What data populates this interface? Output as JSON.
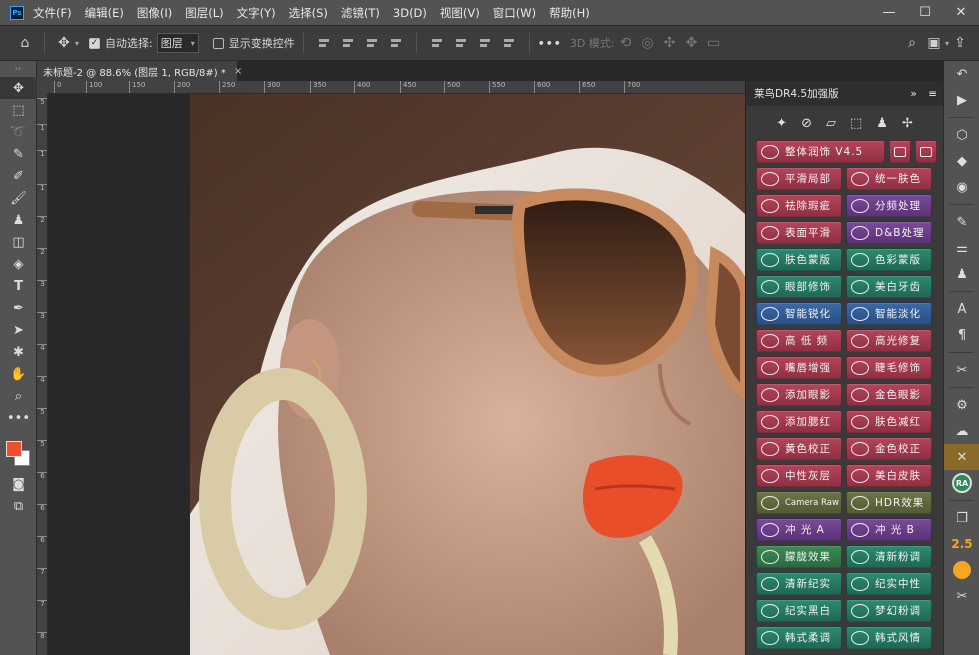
{
  "app": {
    "logo": "Ps"
  },
  "menu": [
    "文件(F)",
    "编辑(E)",
    "图像(I)",
    "图层(L)",
    "文字(Y)",
    "选择(S)",
    "滤镜(T)",
    "3D(D)",
    "视图(V)",
    "窗口(W)",
    "帮助(H)"
  ],
  "window_controls": {
    "minimize": "—",
    "maximize": "☐",
    "close": "✕"
  },
  "options": {
    "auto_select_label": "自动选择:",
    "auto_select_checked": true,
    "auto_select_value": "图层",
    "show_transform_label": "显示变换控件",
    "more": "•••",
    "mode_3d": "3D 模式:"
  },
  "document": {
    "tab_title": "未标题-2 @ 88.6% (图层 1, RGB/8#) *",
    "close": "×"
  },
  "ruler": {
    "top": [
      "0",
      "100",
      "150",
      "200",
      "250",
      "300",
      "350",
      "400",
      "450",
      "500",
      "550",
      "600",
      "650",
      "700"
    ],
    "left": [
      "5",
      "1",
      "1",
      "1",
      "2",
      "2",
      "3",
      "3",
      "4",
      "4",
      "5",
      "5",
      "6",
      "6",
      "6",
      "7",
      "7",
      "8"
    ]
  },
  "colors": {
    "foreground": "#ef4f2c",
    "background": "#ffffff"
  },
  "panel": {
    "title": "莱鸟DR4.5加强版",
    "collapse": "»",
    "menu": "≡",
    "rows": [
      [
        {
          "label": "整体润饰 V4.5",
          "color": "red",
          "wide": true
        }
      ],
      [
        {
          "label": "平滑局部",
          "color": "red"
        },
        {
          "label": "统一肤色",
          "color": "red"
        }
      ],
      [
        {
          "label": "祛除瑕疵",
          "color": "red"
        },
        {
          "label": "分频处理",
          "color": "purple"
        }
      ],
      [
        {
          "label": "表面平滑",
          "color": "red"
        },
        {
          "label": "D&B处理",
          "color": "purple"
        }
      ],
      [
        {
          "label": "肤色蒙版",
          "color": "teal"
        },
        {
          "label": "色彩蒙版",
          "color": "teal"
        }
      ],
      [
        {
          "label": "眼部修饰",
          "color": "teal"
        },
        {
          "label": "美白牙齿",
          "color": "teal"
        }
      ],
      [
        {
          "label": "智能锐化",
          "color": "blue"
        },
        {
          "label": "智能淡化",
          "color": "blue"
        }
      ],
      [
        {
          "label": "高 低 频",
          "color": "red"
        },
        {
          "label": "高光修复",
          "color": "red"
        }
      ],
      [
        {
          "label": "嘴唇增强",
          "color": "red"
        },
        {
          "label": "睫毛修饰",
          "color": "red"
        }
      ],
      [
        {
          "label": "添加眼影",
          "color": "red"
        },
        {
          "label": "金色眼影",
          "color": "red"
        }
      ],
      [
        {
          "label": "添加腮红",
          "color": "red"
        },
        {
          "label": "肤色减红",
          "color": "red"
        }
      ],
      [
        {
          "label": "黄色校正",
          "color": "red"
        },
        {
          "label": "金色校正",
          "color": "red"
        }
      ],
      [
        {
          "label": "中性灰层",
          "color": "red"
        },
        {
          "label": "美白皮肤",
          "color": "red"
        }
      ],
      [
        {
          "label": "Camera Raw",
          "color": "olive"
        },
        {
          "label": "HDR效果",
          "color": "olive"
        }
      ],
      [
        {
          "label": "冲 光 A",
          "color": "purple"
        },
        {
          "label": "冲 光 B",
          "color": "purple"
        }
      ],
      [
        {
          "label": "朦胧效果",
          "color": "green"
        },
        {
          "label": "清新粉调",
          "color": "teal"
        }
      ],
      [
        {
          "label": "清新纪实",
          "color": "teal"
        },
        {
          "label": "纪实中性",
          "color": "teal"
        }
      ],
      [
        {
          "label": "纪实黑白",
          "color": "teal"
        },
        {
          "label": "梦幻粉调",
          "color": "teal"
        }
      ],
      [
        {
          "label": "韩式柔调",
          "color": "teal"
        },
        {
          "label": "韩式风情",
          "color": "teal"
        }
      ]
    ]
  },
  "dock": {
    "ra_label": "RA",
    "number_label": "2.5"
  }
}
